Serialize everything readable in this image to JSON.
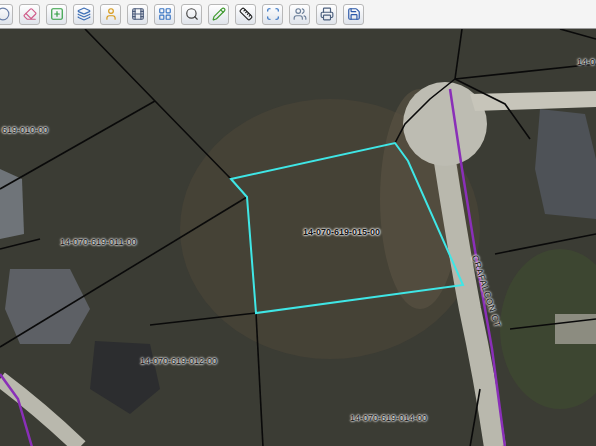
{
  "map": {
    "parcels": [
      {
        "label": "14-070-619-015-00",
        "selected": true
      },
      {
        "label": "14-070-619-011-00",
        "selected": false
      },
      {
        "label": "14-070-619-012-00",
        "selected": false
      },
      {
        "label": "14-070-619-014-00",
        "selected": false
      },
      {
        "label": "619-010-00",
        "selected": false
      },
      {
        "label": "14-0",
        "selected": false
      }
    ],
    "streets": [
      {
        "label": "CRAFALCON CT"
      }
    ]
  }
}
